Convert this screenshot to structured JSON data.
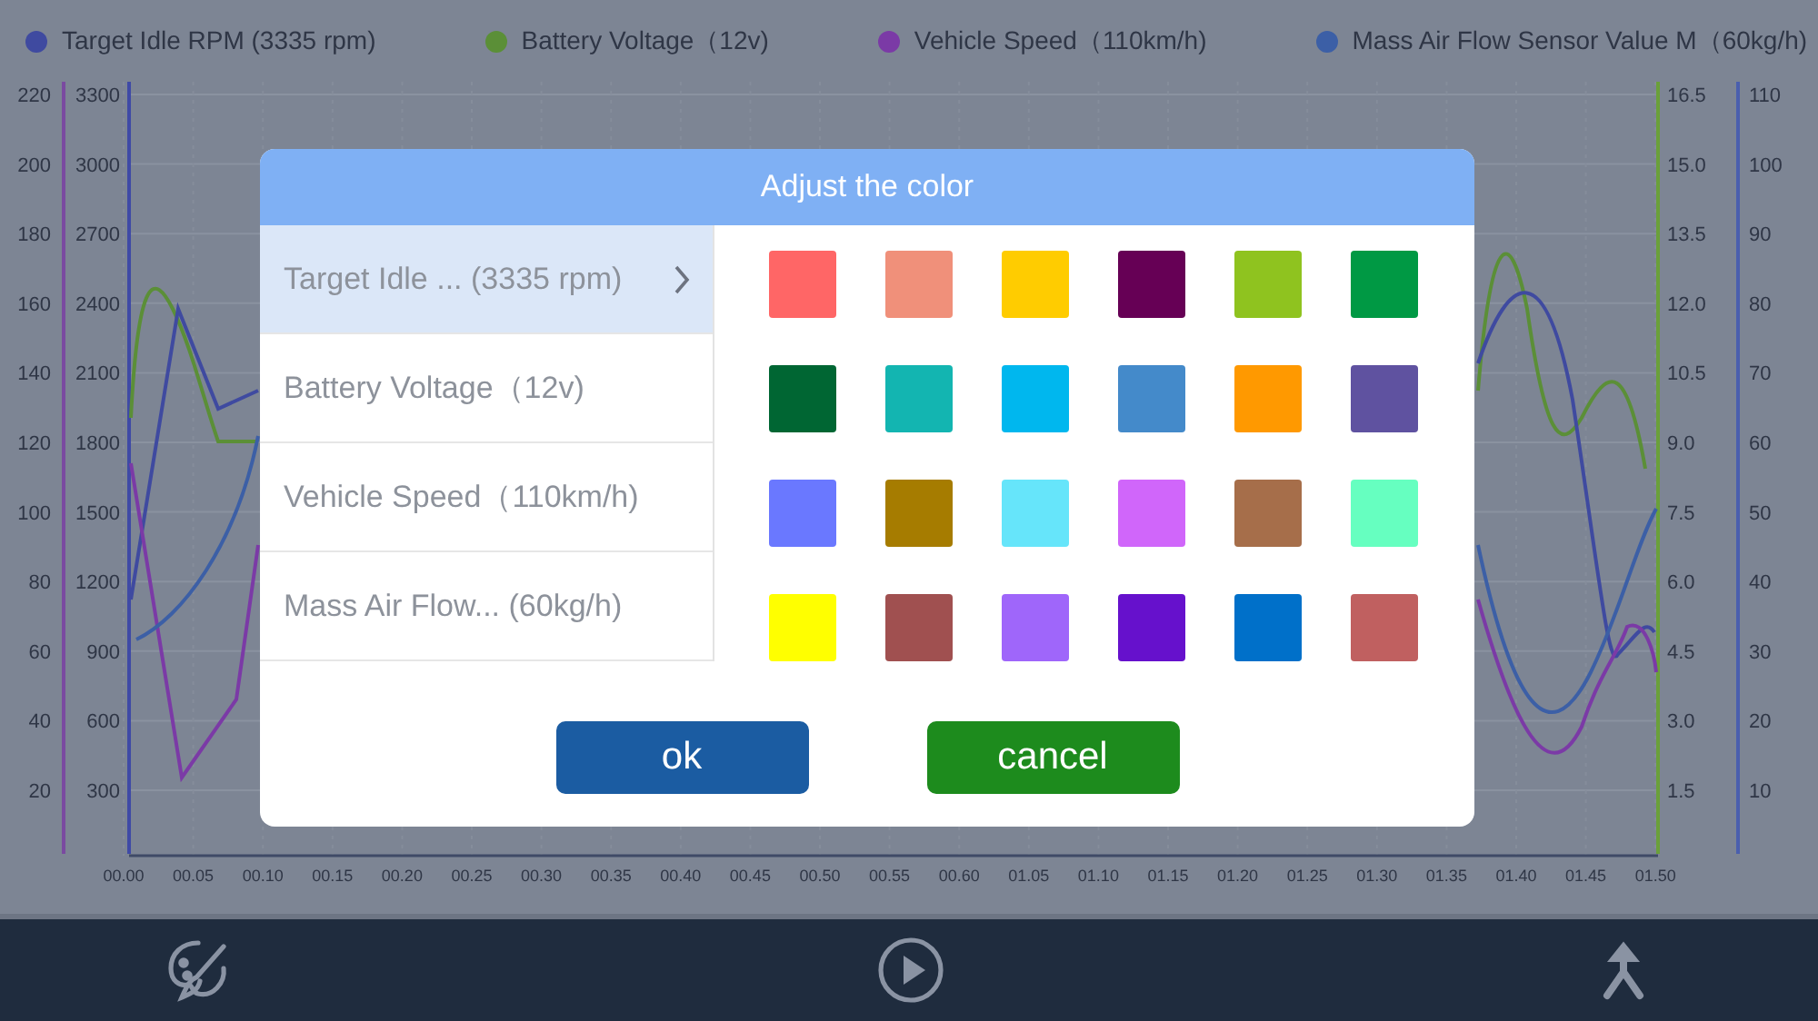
{
  "legend": [
    {
      "label": "Target Idle RPM (3335 rpm)",
      "color": "#3f4aa0"
    },
    {
      "label": "Battery Voltage（12v)",
      "color": "#5b8f37"
    },
    {
      "label": "Vehicle Speed（110km/h)",
      "color": "#7b3aa6"
    },
    {
      "label": "Mass Air Flow Sensor Value M（60kg/h)",
      "color": "#3c5fa6"
    }
  ],
  "chart": {
    "left_axes": [
      {
        "color": "#7a4aa0",
        "ticks": [
          "220",
          "200",
          "180",
          "160",
          "140",
          "120",
          "100",
          "80",
          "60",
          "40",
          "20"
        ]
      },
      {
        "color": "#3f4aa6",
        "ticks": [
          "3300",
          "3000",
          "2700",
          "2400",
          "2100",
          "1800",
          "1500",
          "1200",
          "900",
          "600",
          "300"
        ]
      }
    ],
    "right_axes": [
      {
        "color": "#6aa03a",
        "ticks": [
          "16.5",
          "15.0",
          "13.5",
          "12.0",
          "10.5",
          "9.0",
          "7.5",
          "6.0",
          "4.5",
          "3.0",
          "1.5"
        ]
      },
      {
        "color": "#4a5fae",
        "ticks": [
          "110",
          "100",
          "90",
          "80",
          "70",
          "60",
          "50",
          "40",
          "30",
          "20",
          "10"
        ]
      }
    ],
    "x_ticks": [
      "00.00",
      "00.05",
      "00.10",
      "00.15",
      "00.20",
      "00.25",
      "00.30",
      "00.35",
      "00.40",
      "00.45",
      "00.50",
      "00.55",
      "00.60",
      "01.05",
      "01.10",
      "01.15",
      "01.20",
      "01.25",
      "01.30",
      "01.35",
      "01.40",
      "01.45",
      "01.50"
    ]
  },
  "dialog": {
    "title": "Adjust the color",
    "items": [
      {
        "label": "Target Idle ... (3335 rpm)",
        "selected": true
      },
      {
        "label": "Battery Voltage（12v)",
        "selected": false
      },
      {
        "label": "Vehicle Speed（110km/h)",
        "selected": false
      },
      {
        "label": "Mass Air Flow... (60kg/h)",
        "selected": false
      }
    ],
    "swatches": [
      {
        "color": "#ff6666"
      },
      {
        "color": "#f0907a"
      },
      {
        "color": "#ffcc00"
      },
      {
        "color": "#660055"
      },
      {
        "color": "#8fc31f"
      },
      {
        "color": "#009944"
      },
      {
        "color": "#006633"
      },
      {
        "color": "#13b5b1"
      },
      {
        "color": "#00b7ee"
      },
      {
        "color": "#448aca"
      },
      {
        "color": "#ff9900"
      },
      {
        "color": "#5f52a0"
      },
      {
        "color": "#6a78ff"
      },
      {
        "color": "#a67c00"
      },
      {
        "color": "#66e5fa"
      },
      {
        "color": "#d066fa"
      },
      {
        "color": "#a66e4a"
      },
      {
        "color": "#66ffc0"
      },
      {
        "color": "#ffff00"
      },
      {
        "color": "#a05050"
      },
      {
        "color": "#9f66fa"
      },
      {
        "color": "#6611cc"
      },
      {
        "color": "#0070c9"
      },
      {
        "color": "#c06060"
      }
    ],
    "buttons": [
      {
        "label": "ok",
        "kind": "primary"
      },
      {
        "label": "cancel",
        "kind": "secondary"
      }
    ]
  }
}
